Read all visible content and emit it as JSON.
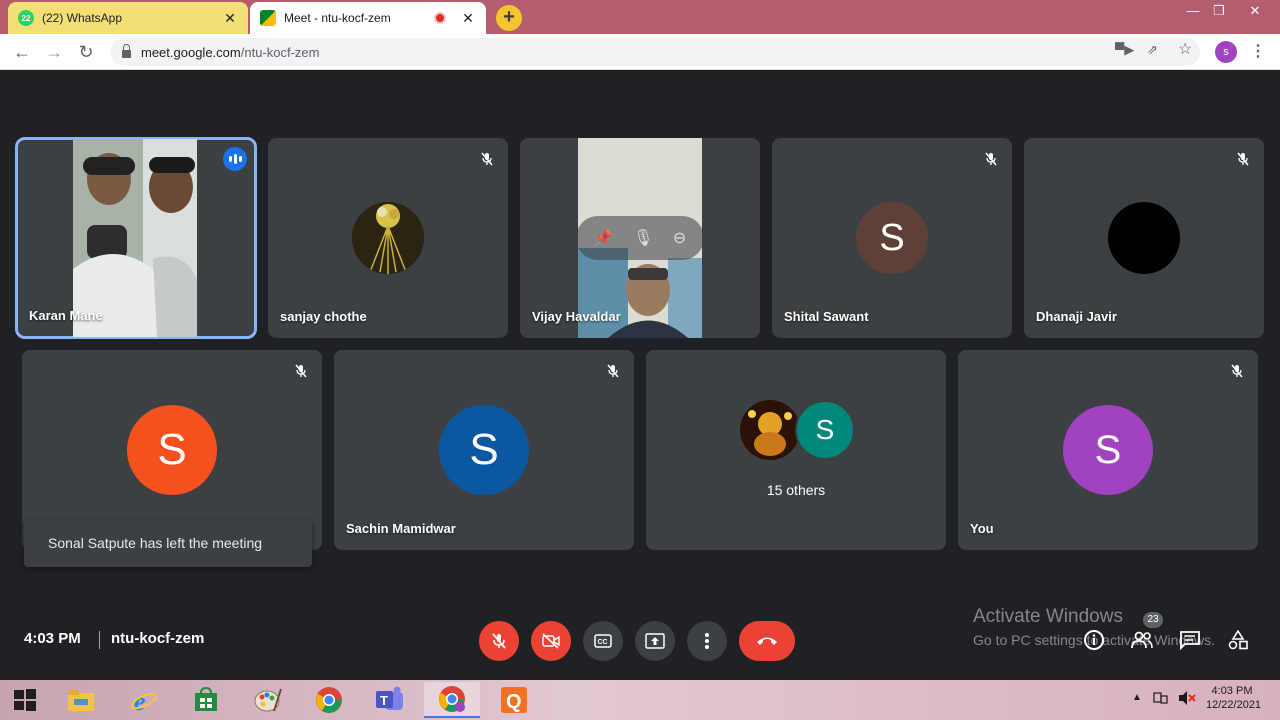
{
  "browser": {
    "tabs": [
      {
        "title": "(22) WhatsApp",
        "badge": "22",
        "active": false
      },
      {
        "title": "Meet - ntu-kocf-zem",
        "active": true
      }
    ],
    "url_domain": "meet.google.com",
    "url_path": "/ntu-kocf-zem",
    "profile_initial": "s"
  },
  "meeting": {
    "participants": [
      {
        "name": "Karan Mane",
        "speaking": true,
        "video": true
      },
      {
        "name": "sanjay chothe",
        "muted": true,
        "avatar": "photo"
      },
      {
        "name": "Vijay Havaldar",
        "video": true
      },
      {
        "name": "Shital Sawant",
        "muted": true,
        "initial": "S",
        "color": "#5d4037"
      },
      {
        "name": "Dhanaji Javir",
        "muted": true,
        "avatar": "black",
        "color": "#000000"
      },
      {
        "name": "",
        "muted": true,
        "initial": "S",
        "color": "#f4511e"
      },
      {
        "name": "Sachin Mamidwar",
        "muted": true,
        "initial": "S",
        "color": "#0b57a0"
      },
      {
        "name": "15 others",
        "initial": "S",
        "color": "#00897b"
      },
      {
        "name": "You",
        "muted": true,
        "initial": "S",
        "color": "#a142c1"
      }
    ],
    "toast": "Sonal Satpute has left the meeting",
    "time": "4:03 PM",
    "meeting_code": "ntu-kocf-zem",
    "people_count": "23"
  },
  "watermark": {
    "line1": "Activate Windows",
    "line2": "Go to PC settings to activate Windows."
  },
  "taskbar": {
    "time": "4:03 PM",
    "date": "12/22/2021"
  }
}
